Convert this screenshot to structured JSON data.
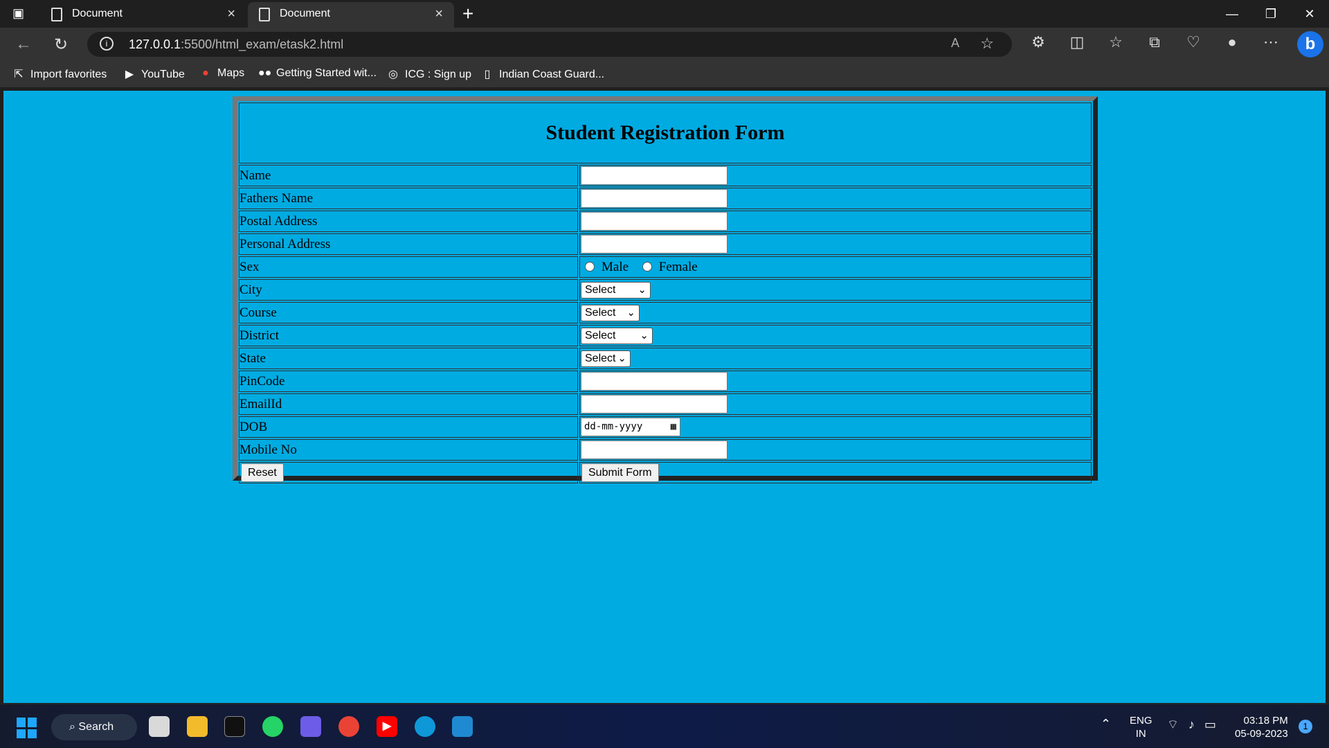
{
  "browser": {
    "tabs": [
      {
        "title": "Document"
      },
      {
        "title": "Document"
      }
    ],
    "url": {
      "host": "127.0.0.1",
      "path": ":5500/html_exam/etask2.html"
    },
    "bookmarks": [
      {
        "label": "Import favorites",
        "icon": "import-icon"
      },
      {
        "label": "YouTube",
        "icon": "youtube-icon"
      },
      {
        "label": "Maps",
        "icon": "maps-pin-icon"
      },
      {
        "label": "Getting Started wit...",
        "icon": "medium-icon"
      },
      {
        "label": "ICG : Sign up",
        "icon": "emblem-icon"
      },
      {
        "label": "Indian Coast Guard...",
        "icon": "document-icon"
      }
    ]
  },
  "form": {
    "title": "Student Registration Form",
    "labels": {
      "name": "Name",
      "fathers_name": "Fathers Name",
      "postal_address": "Postal Address",
      "personal_address": "Personal Address",
      "sex": "Sex",
      "city": "City",
      "course": "Course",
      "district": "District",
      "state": "State",
      "pincode": "PinCode",
      "email": "EmailId",
      "dob": "DOB",
      "mobile": "Mobile No"
    },
    "sex_options": {
      "male": "Male",
      "female": "Female"
    },
    "selects": {
      "city": "Select",
      "course": "Select",
      "district": "Select",
      "state": "Select"
    },
    "dob_placeholder": "dd-mm-yyyy",
    "buttons": {
      "reset": "Reset",
      "submit": "Submit Form"
    }
  },
  "taskbar": {
    "search_label": "Search",
    "language": {
      "line1": "ENG",
      "line2": "IN"
    },
    "clock": {
      "time": "03:18 PM",
      "date": "05-09-2023"
    },
    "notification_count": "1"
  },
  "colors": {
    "page_background": "#00abe2",
    "browser_chrome": "#333333"
  }
}
